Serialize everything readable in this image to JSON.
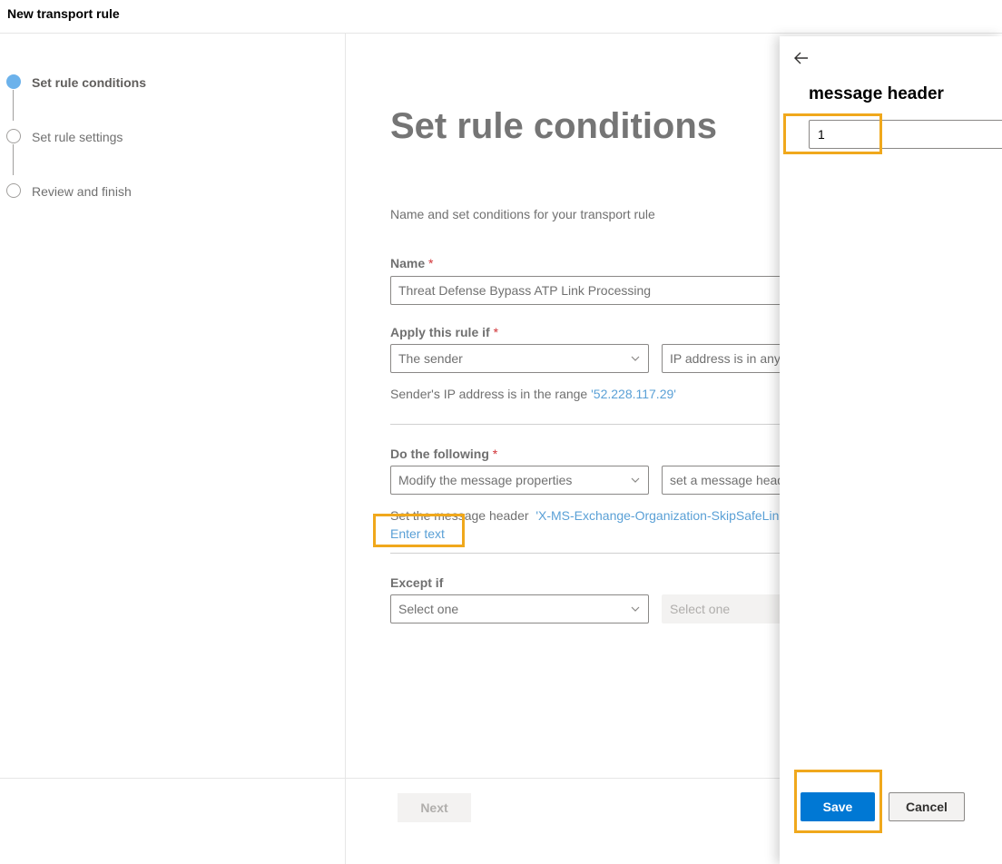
{
  "window": {
    "title": "New transport rule"
  },
  "steps": [
    {
      "label": "Set rule conditions",
      "state": "active"
    },
    {
      "label": "Set rule settings",
      "state": "pending"
    },
    {
      "label": "Review and finish",
      "state": "pending"
    }
  ],
  "main": {
    "title": "Set rule conditions",
    "description": "Name and set conditions for your transport rule",
    "name_label": "Name",
    "name_value": "Threat Defense Bypass ATP Link Processing",
    "required_mark": "*",
    "apply_label": "Apply this rule if",
    "apply_dropdown_1": "The sender",
    "apply_dropdown_2": "IP address is in any",
    "apply_summary_text": "Sender's IP address is in the range",
    "apply_summary_link": "'52.228.117.29'",
    "do_label": "Do the following",
    "do_dropdown_1": "Modify the message properties",
    "do_dropdown_2": "set a message head",
    "do_summary_text": "Set the message header",
    "do_summary_link": "'X-MS-Exchange-Organization-SkipSafeLinks",
    "enter_text_link": "Enter text",
    "except_label": "Except if",
    "except_dropdown_1": "Select one",
    "except_dropdown_2": "Select one"
  },
  "footer": {
    "next_label": "Next"
  },
  "panel": {
    "title": "message header",
    "input_value": "1",
    "save_label": "Save",
    "cancel_label": "Cancel"
  },
  "colors": {
    "accent": "#0078d4",
    "link": "#5aa0d6",
    "highlight": "#f0a81c",
    "active_step": "#6cb2eb",
    "required": "#d13438"
  },
  "icons": [
    "back-arrow-icon",
    "chevron-down-icon"
  ]
}
